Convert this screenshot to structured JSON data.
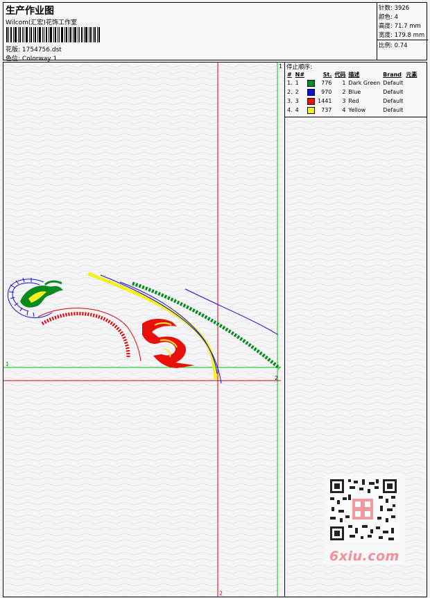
{
  "header": {
    "title": "生产作业图",
    "subtitle": "Wilcom(汇宏)花饰工作室",
    "design_label": "花版:",
    "design_value": "1754756.dst",
    "colorway_label": "色位:",
    "colorway_value": "Colorway 1"
  },
  "stats": {
    "stitches_label": "针数:",
    "stitches_value": "3926",
    "colors_label": "颜色:",
    "colors_value": "4",
    "height_label": "高度:",
    "height_value": "71.7 mm",
    "width_label": "宽度:",
    "width_value": "179.8 mm",
    "scale_label": "比例:",
    "scale_value": "0.74"
  },
  "legend": {
    "title": "停止顺序:",
    "columns": [
      "#",
      "N#",
      "St.",
      "代码",
      "描述",
      "Brand",
      "元素"
    ],
    "rows": [
      {
        "index": "1.",
        "n": "1",
        "stitches": "776",
        "code": "1",
        "description": "Dark Green",
        "brand": "Default",
        "color": "#0a8a1e"
      },
      {
        "index": "2.",
        "n": "2",
        "stitches": "970",
        "code": "2",
        "description": "Blue",
        "brand": "Default",
        "color": "#1010d8"
      },
      {
        "index": "3.",
        "n": "3",
        "stitches": "1441",
        "code": "3",
        "description": "Red",
        "brand": "Default",
        "color": "#e8100a"
      },
      {
        "index": "4.",
        "n": "4",
        "stitches": "737",
        "code": "4",
        "description": "Yellow",
        "brand": "Default",
        "color": "#f5f020"
      }
    ]
  },
  "guides": {
    "top_marker": "1",
    "left_marker": "1",
    "right_marker": "2",
    "bottom_marker": "2",
    "green_color": "#00cc00",
    "red_color": "#e00000"
  },
  "watermark": {
    "brand": "6xiu.com",
    "seal_text": "日月刺绣"
  }
}
